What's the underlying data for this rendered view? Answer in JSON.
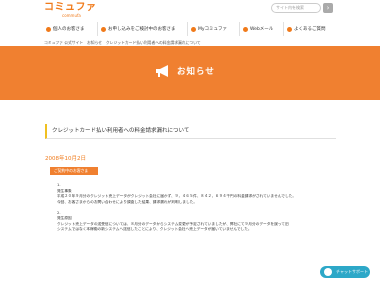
{
  "header": {
    "logo_main": "コミュファ",
    "logo_sub": "commufa",
    "search_placeholder": "サイト内を検索",
    "search_button": "›"
  },
  "nav": {
    "items": [
      {
        "label": "個人のお客さま",
        "icon": "person-icon"
      },
      {
        "label": "お申し込みをご検討中のお客さま",
        "icon": "clipboard-icon"
      },
      {
        "label": "Myコミュファ",
        "icon": "heart-icon"
      },
      {
        "label": "Webメール",
        "icon": "mail-icon"
      },
      {
        "label": "よくあるご質問",
        "icon": "question-icon"
      }
    ]
  },
  "breadcrumb": "コミュファ 公式サイト　お知らせ　クレジットカード払い利用者への料金請求漏れについて",
  "hero": {
    "title": "お知らせ",
    "color": "#f08030"
  },
  "article": {
    "title": "クレジットカード払い利用者への料金請求漏れについて",
    "date": "2008年10月2日",
    "category": "ご契約中のお客さま",
    "body": [
      "1.",
      "発生事象",
      "平成２０年９月分のクレジット売上データがクレジット会社に届かず、９，４６５件、８４２，６９４千円の料金請求がされていませんでした。",
      "今回、お客さまからのお問い合わせにより調査した結果、請求漏れが判明しました。",
      "",
      "2.",
      "発生原因",
      "クレジット売上データの送受信については、８月分のデータからシステム変更が予定されていましたが、弊社にて９月分のデータを誤って旧",
      "システムではなく本稼働の新システムへ送信したことにより、クレジット会社へ売上データが届いていませんでした。"
    ]
  },
  "chat": {
    "label": "チャットサポート",
    "color": "#2da8c8"
  }
}
